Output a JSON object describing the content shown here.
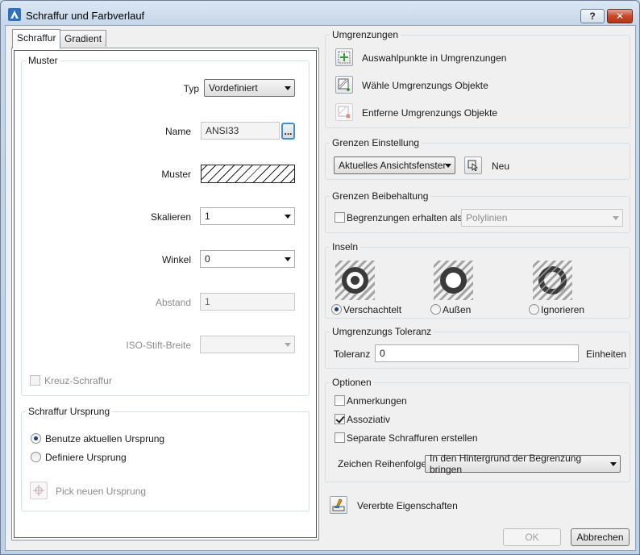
{
  "window": {
    "title": "Schraffur und Farbverlauf",
    "help_label": "?",
    "close_label": "✕"
  },
  "tabs": [
    {
      "label": "Schraffur"
    },
    {
      "label": "Gradient"
    }
  ],
  "muster_group": {
    "title": "Muster",
    "typ_label": "Typ",
    "typ_value": "Vordefiniert",
    "name_label": "Name",
    "name_value": "ANSI33",
    "browse_label": "...",
    "muster_label": "Muster",
    "skalieren_label": "Skalieren",
    "skalieren_value": "1",
    "winkel_label": "Winkel",
    "winkel_value": "0",
    "abstand_label": "Abstand",
    "abstand_value": "1",
    "iso_label": "ISO-Stift-Breite",
    "iso_value": "",
    "kreuz_label": "Kreuz-Schraffur"
  },
  "ursprung_group": {
    "title": "Schraffur Ursprung",
    "option1": "Benutze aktuellen Ursprung",
    "option2": "Definiere Ursprung",
    "pick_label": "Pick neuen Ursprung"
  },
  "umgrenzungen": {
    "title": "Umgrenzungen",
    "auswahl": "Auswahlpunkte in Umgrenzungen",
    "waehle": "Wähle Umgrenzungs Objekte",
    "entferne": "Entferne Umgrenzungs Objekte"
  },
  "grenzen_einstellung": {
    "title": "Grenzen Einstellung",
    "value": "Aktuelles Ansichtsfenster",
    "neu_label": "Neu"
  },
  "grenzen_beibehaltung": {
    "title": "Grenzen Beibehaltung",
    "checkbox_label": "Begrenzungen erhalten als",
    "value": "Polylinien"
  },
  "inseln": {
    "title": "Inseln",
    "options": [
      {
        "label": "Verschachtelt"
      },
      {
        "label": "Außen"
      },
      {
        "label": "Ignorieren"
      }
    ]
  },
  "toleranz": {
    "title": "Umgrenzungs Toleranz",
    "label": "Toleranz",
    "value": "0",
    "unit": "Einheiten"
  },
  "optionen": {
    "title": "Optionen",
    "anmerkungen": "Anmerkungen",
    "assoziativ": "Assoziativ",
    "separate": "Separate Schraffuren erstellen",
    "reihenfolge_label": "Zeichen Reihenfolge",
    "reihenfolge_value": "In den Hintergrund der Begrenzung bringen"
  },
  "vererbte_label": "Vererbte Eigenschaften",
  "buttons": {
    "ok": "OK",
    "cancel": "Abbrechen"
  }
}
